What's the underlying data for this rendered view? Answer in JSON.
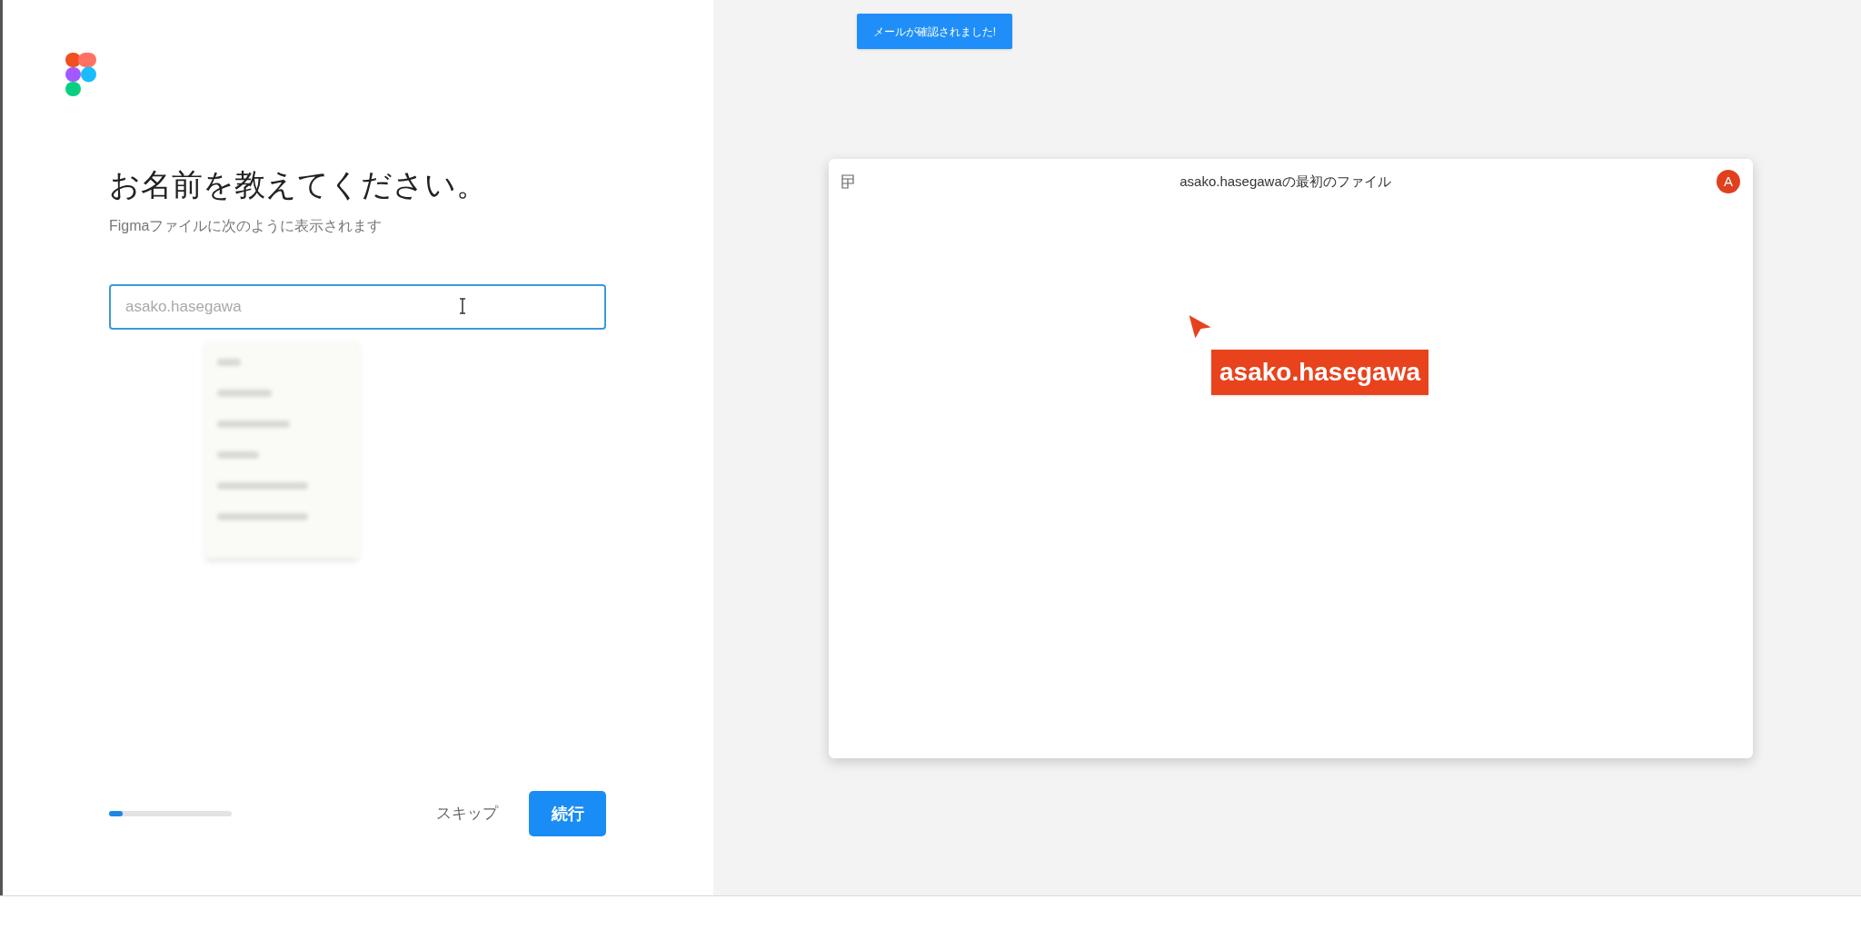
{
  "heading": "お名前を教えてください。",
  "subtitle": "Figmaファイルに次のように表示されます",
  "name_field": {
    "placeholder": "asako.hasegawa"
  },
  "progress": {
    "level": 0.11
  },
  "skip_button": "スキップ",
  "continue_button": "続行",
  "toast": "メールが確認されました!",
  "preview": {
    "file_title": "asako.hasegawaの最初のファイル",
    "avatar": "A",
    "cursor_label": "asako.hasegawa"
  }
}
